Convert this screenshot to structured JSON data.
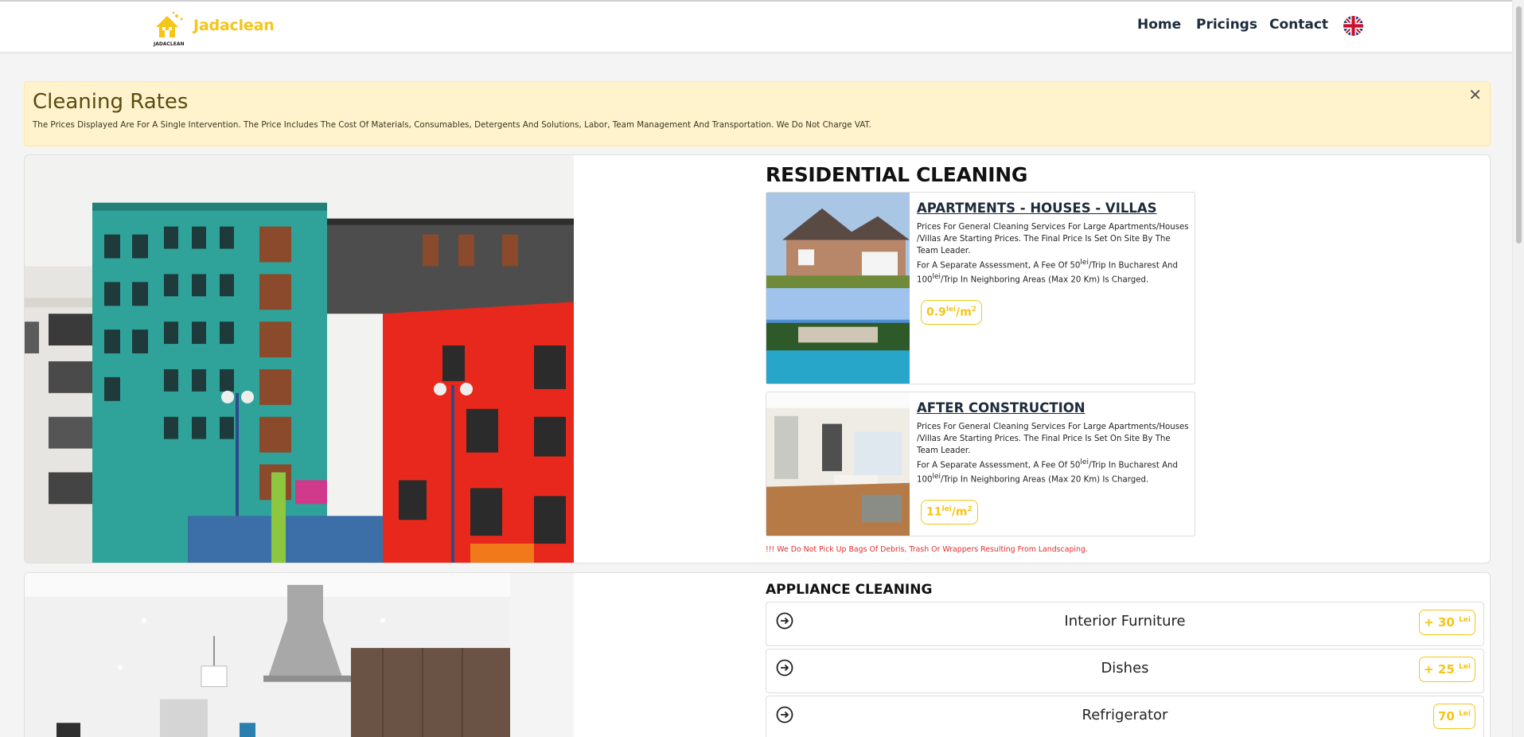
{
  "navbar": {
    "brand": "Jadaclean",
    "logo_text": "JADACLEAN",
    "links": [
      {
        "label": "Home"
      },
      {
        "label": "Pricings"
      },
      {
        "label": "Contact"
      }
    ],
    "language_icon": "uk-flag-icon"
  },
  "alert": {
    "title": "Cleaning Rates",
    "text": "The Prices Displayed Are For A Single Intervention. The Price Includes The Cost Of Materials, Consumables, Detergents And Solutions, Labor, Team Management And Transportation. We Do Not Charge VAT.",
    "close": "✕"
  },
  "residential": {
    "title": "RESIDENTIAL CLEANING",
    "services": [
      {
        "name": "APARTMENTS - HOUSES - VILLAS",
        "desc": "Prices For General Cleaning Services For Large Apartments/Houses /Villas Are Starting Prices. The Final Price Is Set On Site By The Team Leader.",
        "fee_a": "For A Separate Assessment, A Fee Of 50",
        "fee_b": "/Trip In Bucharest And 100",
        "fee_c": "/Trip In Neighboring Areas (Max 20 Km) Is Charged.",
        "fee_unit": "lei",
        "price_value": "0.9",
        "price_unit": "lei",
        "price_suffix": "/m",
        "price_exp": "2"
      },
      {
        "name": "AFTER CONSTRUCTION",
        "desc": "Prices For General Cleaning Services For Large Apartments/Houses /Villas Are Starting Prices. The Final Price Is Set On Site By The Team Leader.",
        "fee_a": "For A Separate Assessment, A Fee Of 50",
        "fee_b": "/Trip In Bucharest And 100",
        "fee_c": "/Trip In Neighboring Areas (Max 20 Km) Is Charged.",
        "fee_unit": "lei",
        "price_value": "11",
        "price_unit": "lei",
        "price_suffix": "/m",
        "price_exp": "2"
      }
    ],
    "warning": "!!! We Do Not Pick Up Bags Of Debris, Trash Or Wrappers Resulting From Landscaping."
  },
  "appliance": {
    "title": "APPLIANCE CLEANING",
    "items": [
      {
        "label": "Interior Furniture",
        "price": "+ 30",
        "unit": "Lei"
      },
      {
        "label": "Dishes",
        "price": "+ 25",
        "unit": "Lei"
      },
      {
        "label": "Refrigerator",
        "price": "70",
        "unit": "Lei"
      }
    ]
  },
  "colors": {
    "accent": "#f5c518",
    "alert_bg": "#fff3cd",
    "nav_text": "#1d2b3a",
    "warning": "#e03030"
  }
}
